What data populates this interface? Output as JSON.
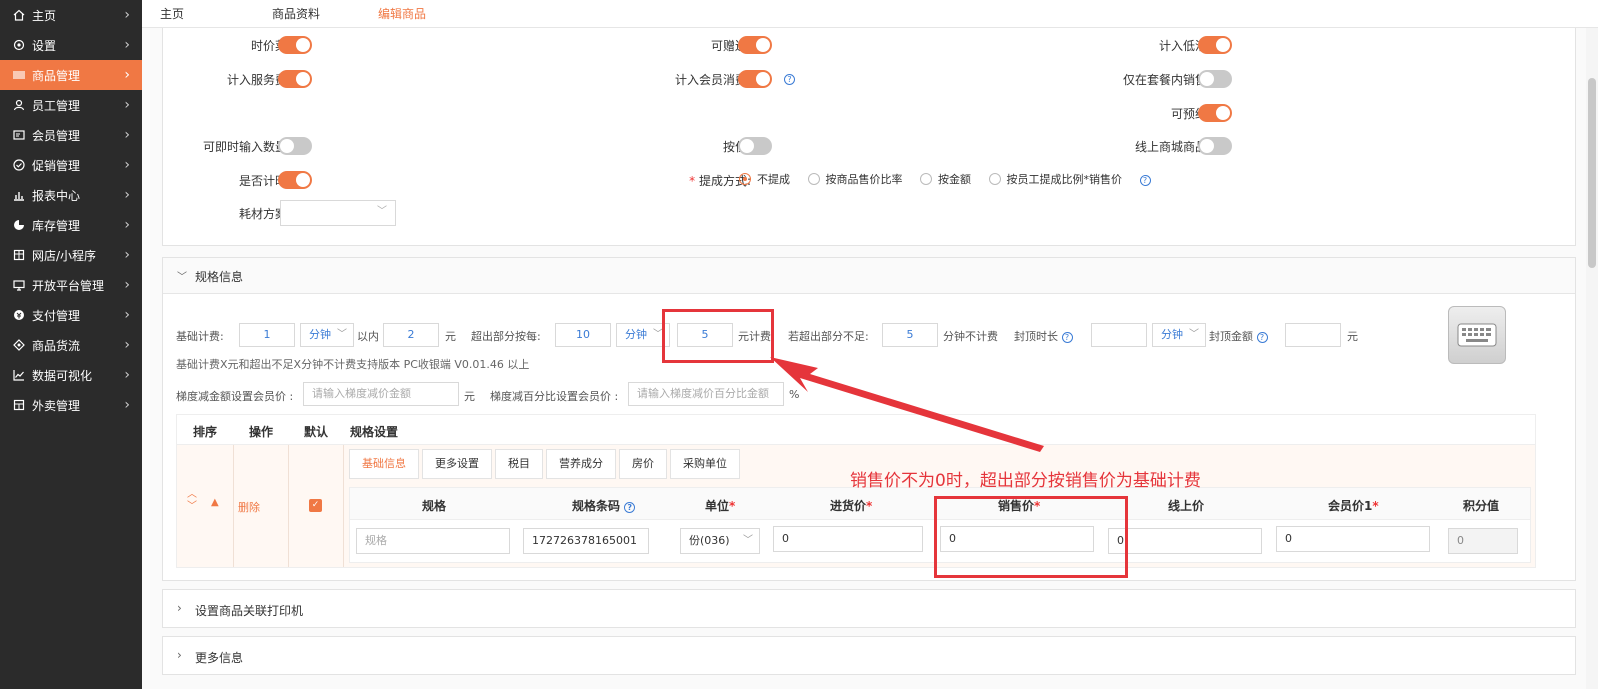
{
  "sidebar": {
    "items": [
      {
        "label": "主页",
        "icon": "home-icon"
      },
      {
        "label": "设置",
        "icon": "gear-icon"
      },
      {
        "label": "商品管理",
        "icon": "barcode-icon"
      },
      {
        "label": "员工管理",
        "icon": "user-icon"
      },
      {
        "label": "会员管理",
        "icon": "member-card-icon"
      },
      {
        "label": "促销管理",
        "icon": "check-circle-icon"
      },
      {
        "label": "报表中心",
        "icon": "bar-chart-icon"
      },
      {
        "label": "库存管理",
        "icon": "pie-chart-icon"
      },
      {
        "label": "网店/小程序",
        "icon": "shop-icon"
      },
      {
        "label": "开放平台管理",
        "icon": "monitor-icon"
      },
      {
        "label": "支付管理",
        "icon": "payment-icon"
      },
      {
        "label": "商品货流",
        "icon": "flow-icon"
      },
      {
        "label": "数据可视化",
        "icon": "line-chart-icon"
      },
      {
        "label": "外卖管理",
        "icon": "store-icon"
      }
    ],
    "active_index": 2
  },
  "tabs": [
    "主页",
    "商品资料",
    "编辑商品"
  ],
  "settings": {
    "price_dish": "时价菜:",
    "can_gift": "可赠送:",
    "count_min": "计入低消:",
    "service_fee": "计入服务费:",
    "member_spend": "计入会员消费:",
    "only_set_meal": "仅在套餐内销售:",
    "can_reserve": "可预约:",
    "instant_qty": "可即时输入数量:",
    "by_position": "按位:",
    "online_mall": "线上商城商品:",
    "is_timing": "是否计时:",
    "commission_label": "提成方式:",
    "commission_options": [
      "不提成",
      "按商品售价比率",
      "按金额",
      "按员工提成比例*销售价"
    ],
    "consumable_label": "耗材方案:"
  },
  "spec_section": {
    "title": "规格信息",
    "base_fee_label": "基础计费:",
    "base_fee_value": "1",
    "minute_unit": "分钟",
    "within_label": "以内",
    "within_value": "2",
    "yuan": "元",
    "over_label": "超出部分按每:",
    "over_value": "10",
    "over_unit": "分钟",
    "over_price": "5",
    "yuan_fee": "元计费",
    "if_less_label": "若超出部分不足:",
    "if_less_value": "5",
    "no_fee_label": "分钟不计费",
    "cap_time_label": "封顶时长",
    "cap_time_unit": "分钟",
    "cap_amount_label": "封顶金额",
    "cap_yuan": "元",
    "note": "基础计费X元和超出不足X分钟不计费支持版本 PC收银端 V0.01.46 以上",
    "tier_amount_label": "梯度减金额设置会员价 :",
    "tier_amount_ph": "请输入梯度减价金额",
    "tier_amount_unit": "元",
    "tier_pct_label": "梯度减百分比设置会员价 :",
    "tier_pct_ph": "请输入梯度减价百分比金额",
    "tier_pct_unit": "%"
  },
  "table": {
    "headers": [
      "排序",
      "操作",
      "默认",
      "规格设置"
    ],
    "delete_label": "删除",
    "subtabs": [
      "基础信息",
      "更多设置",
      "税目",
      "营养成分",
      "房价",
      "采购单位"
    ],
    "inner_headers": [
      "规格",
      "规格条码",
      "单位",
      "进货价",
      "销售价",
      "线上价",
      "会员价1",
      "积分值"
    ],
    "required_marks": [
      "单位",
      "进货价",
      "销售价",
      "会员价1"
    ],
    "row": {
      "spec_ph": "规格",
      "barcode": "172726378165001",
      "unit": "份(036)",
      "cost": "0",
      "sale": "0",
      "online": "0",
      "member": "0",
      "points": "0"
    }
  },
  "collapsed": [
    "设置商品关联打印机",
    "更多信息"
  ],
  "annotation": "销售价不为0时，超出部分按销售价为基础计费",
  "colors": {
    "accent": "#f07844",
    "annotation_red": "#e5353b",
    "sidebar_bg": "#2b2b2b"
  }
}
